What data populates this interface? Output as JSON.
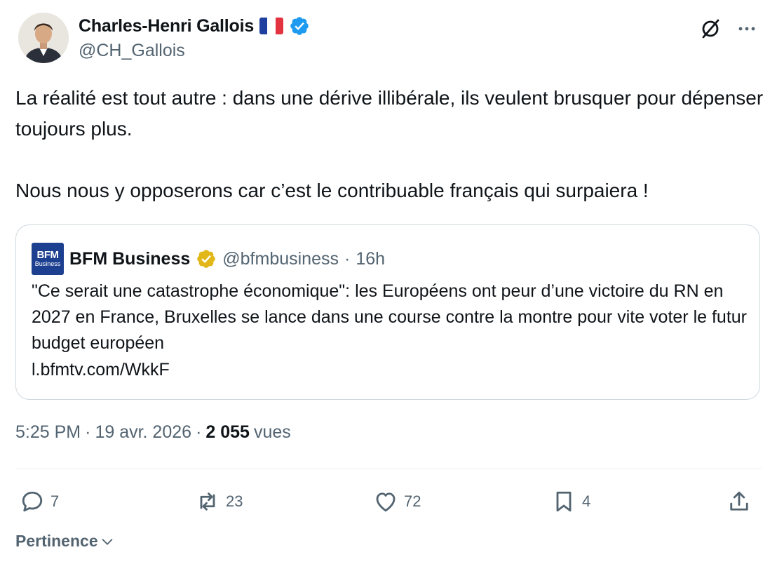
{
  "author": {
    "display_name": "Charles-Henri Gallois",
    "handle": "@CH_Gallois",
    "flag": "french-flag",
    "verified_color": "#1d9bf0"
  },
  "tweet": {
    "text": "La réalité est tout autre : dans une dérive illibérale, ils veulent brusquer pour dépenser toujours plus.\n\nNous nous y opposerons car c’est le contribuable français qui surpaiera !"
  },
  "quoted": {
    "logo_line1": "BFM",
    "logo_line2": "Business",
    "name": "BFM Business",
    "handle": "@bfmbusiness",
    "separator": "·",
    "time": "16h",
    "text": "\"Ce serait une catastrophe économique\": les Européens ont peur d’une victoire du RN en 2027 en France, Bruxelles se lance dans une course contre la montre pour vite voter le futur budget européen",
    "link": "l.bfmtv.com/WkkF",
    "badge_color": "#e2b719"
  },
  "meta": {
    "time": "5:25 PM",
    "sep1": "·",
    "date": "19 avr. 2026",
    "sep2": "·",
    "views_count": "2 055",
    "views_label": "vues"
  },
  "actions": {
    "replies": "7",
    "reposts": "23",
    "likes": "72",
    "bookmarks": "4"
  },
  "sort": {
    "label": "Pertinence"
  },
  "colors": {
    "text": "#0f1419",
    "secondary": "#536471",
    "border": "#cfd9de"
  }
}
